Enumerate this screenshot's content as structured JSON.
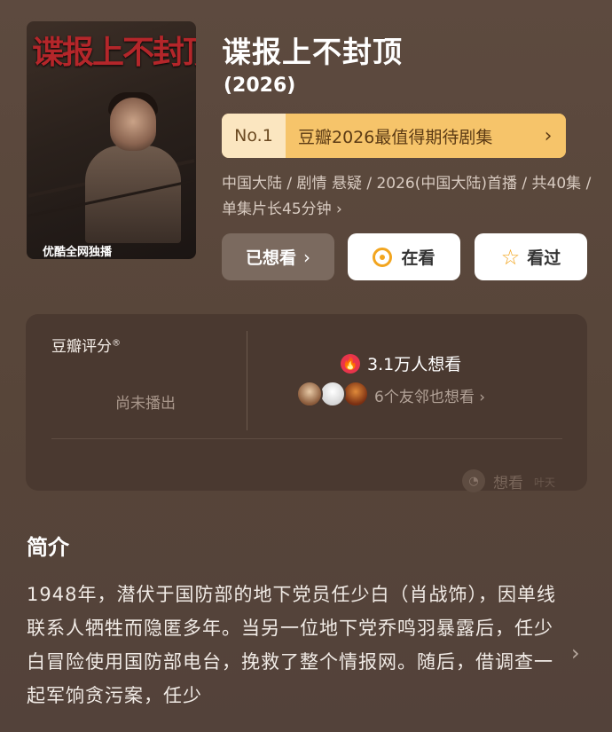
{
  "poster": {
    "title_art": "谍报上不封顶",
    "tag": "优酷全网独播"
  },
  "show": {
    "title": "谍报上不封顶",
    "year": "(2026)"
  },
  "rank": {
    "no": "No.1",
    "text": "豆瓣2026最值得期待剧集",
    "arrow": "›"
  },
  "meta": {
    "line": "中国大陆 / 剧情 悬疑 / 2026(中国大陆)首播 / 共40集 / 单集片长45分钟 ›"
  },
  "actions": {
    "want": "已想看",
    "watching": "在看",
    "watched": "看过"
  },
  "rating": {
    "label": "豆瓣评分",
    "mark": "®",
    "status": "尚未播出",
    "wish_count": "3.1万人想看",
    "friends": "6个友邻也想看 ›"
  },
  "watermark": {
    "text": "想看",
    "sub": "叶天"
  },
  "intro": {
    "heading": "简介",
    "body": "1948年，潜伏于国防部的地下党员任少白（肖战饰），因单线联系人牺牲而隐匿多年。当另一位地下党乔鸣羽暴露后，任少白冒险使用国防部电台，挽救了整个情报网。随后，借调查一起军饷贪污案，任少"
  },
  "colors": {
    "accent": "#f2a51f",
    "rank_bg": "#f6c46a",
    "fire": "#e8354b"
  }
}
